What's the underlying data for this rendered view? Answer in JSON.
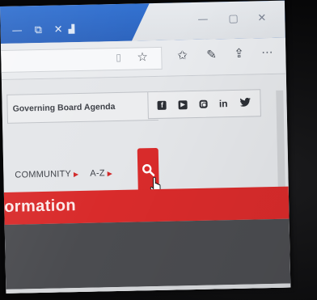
{
  "browser": {
    "title_bar_buttons": [
      "—",
      "⧉",
      "✕"
    ],
    "toolbar_icons": [
      "reading-view-icon",
      "favorite-star-icon",
      "favorites-hub-icon",
      "pen-icon",
      "share-icon",
      "more-icon"
    ],
    "more_label": "···"
  },
  "site": {
    "utility_link": "Governing Board Agenda",
    "social": {
      "facebook": "f",
      "youtube": "▶",
      "linkedin": "in",
      "twitter": "🐦"
    },
    "nav": [
      {
        "label": "COMMUNITY"
      },
      {
        "label": "A-Z"
      }
    ],
    "banner_text": "ormation"
  },
  "colors": {
    "accent_red": "#d92b2b",
    "titlebar_blue": "#2f6fd0",
    "dark_band": "#4b4c50"
  }
}
